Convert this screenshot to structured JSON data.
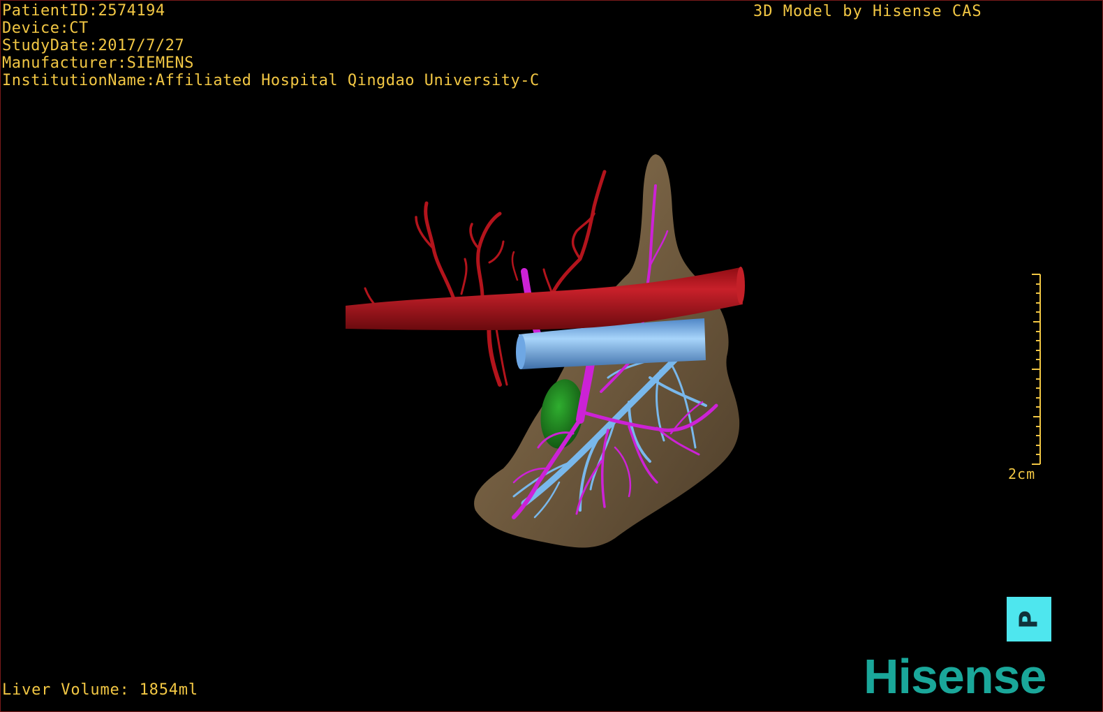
{
  "overlay": {
    "patient_id": "PatientID:2574194",
    "device": "Device:CT",
    "study_date": "StudyDate:2017/7/27",
    "manufacturer": "Manufacturer:SIEMENS",
    "institution": "InstitutionName:Affiliated Hospital Qingdao University-C",
    "model_credit": "3D Model by Hisense CAS",
    "liver_volume": "Liver Volume: 1854ml"
  },
  "scale_bar": {
    "label": "2cm"
  },
  "orientation_cube": {
    "face_label": "P"
  },
  "brand": {
    "logo_text": "Hisense"
  },
  "colors": {
    "overlay_text": "#f2c744",
    "artery": "#b3141c",
    "portal_vein": "#cc22d6",
    "hepatic_vein": "#79b8ec",
    "liver": "#7a6345",
    "gallbladder": "#1d8a1d",
    "orientation_cube": "#4ee6ee",
    "logo": "#1aa79a"
  }
}
